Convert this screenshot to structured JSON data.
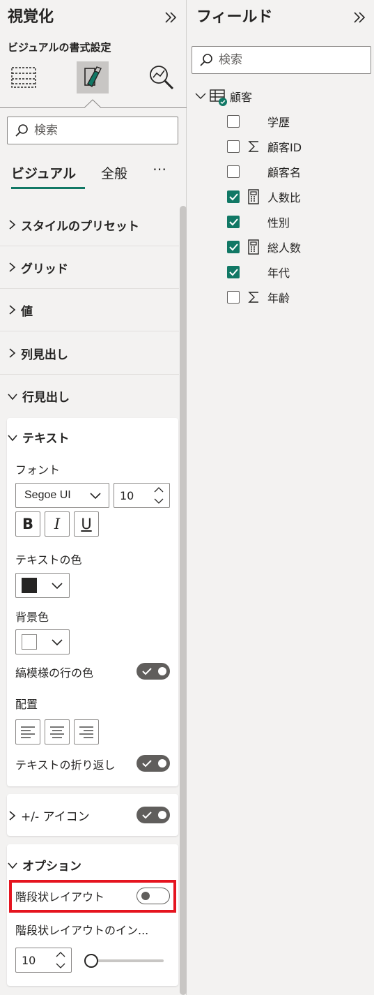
{
  "viz_pane": {
    "title": "視覚化",
    "subtitle": "ビジュアルの書式設定",
    "icons": [
      "table-build-icon",
      "format-paint-icon",
      "analytics-icon"
    ],
    "search": {
      "placeholder": "検索"
    },
    "tabs": [
      "ビジュアル",
      "全般"
    ],
    "more": "⋯",
    "sections": [
      {
        "label": "スタイルのプリセット",
        "expanded": false
      },
      {
        "label": "グリッド",
        "expanded": false
      },
      {
        "label": "値",
        "expanded": false
      },
      {
        "label": "列見出し",
        "expanded": false
      },
      {
        "label": "行見出し",
        "expanded": true
      }
    ],
    "text_card": {
      "title": "テキスト",
      "font_label": "フォント",
      "font_family": "Segoe UI",
      "font_size": "10",
      "bold": "B",
      "italic": "I",
      "underline": "U",
      "text_color_label": "テキストの色",
      "text_color": "#252423",
      "bg_color_label": "背景色",
      "bg_color": "#ffffff",
      "banded_label": "縞模様の行の色",
      "banded_on": true,
      "align_label": "配置",
      "wrap_label": "テキストの折り返し",
      "wrap_on": true
    },
    "icons_card": {
      "title": "+/- アイコン",
      "on": true
    },
    "options_card": {
      "title": "オプション",
      "stepped_label": "階段状レイアウト",
      "stepped_on": false,
      "indent_label": "階段状レイアウトのイン...",
      "indent_value": "10"
    }
  },
  "fields_pane": {
    "title": "フィールド",
    "search": {
      "placeholder": "検索"
    },
    "table": {
      "name": "顧客"
    },
    "fields": [
      {
        "label": "学歴",
        "checked": false,
        "icon": ""
      },
      {
        "label": "顧客ID",
        "checked": false,
        "icon": "sigma-icon"
      },
      {
        "label": "顧客名",
        "checked": false,
        "icon": ""
      },
      {
        "label": "人数比",
        "checked": true,
        "icon": "calculator-icon"
      },
      {
        "label": "性別",
        "checked": true,
        "icon": ""
      },
      {
        "label": "総人数",
        "checked": true,
        "icon": "calculator-icon"
      },
      {
        "label": "年代",
        "checked": true,
        "icon": ""
      },
      {
        "label": "年齢",
        "checked": false,
        "icon": "sigma-icon"
      }
    ]
  },
  "colors": {
    "accent": "#117865",
    "highlight": "#e5141f"
  }
}
